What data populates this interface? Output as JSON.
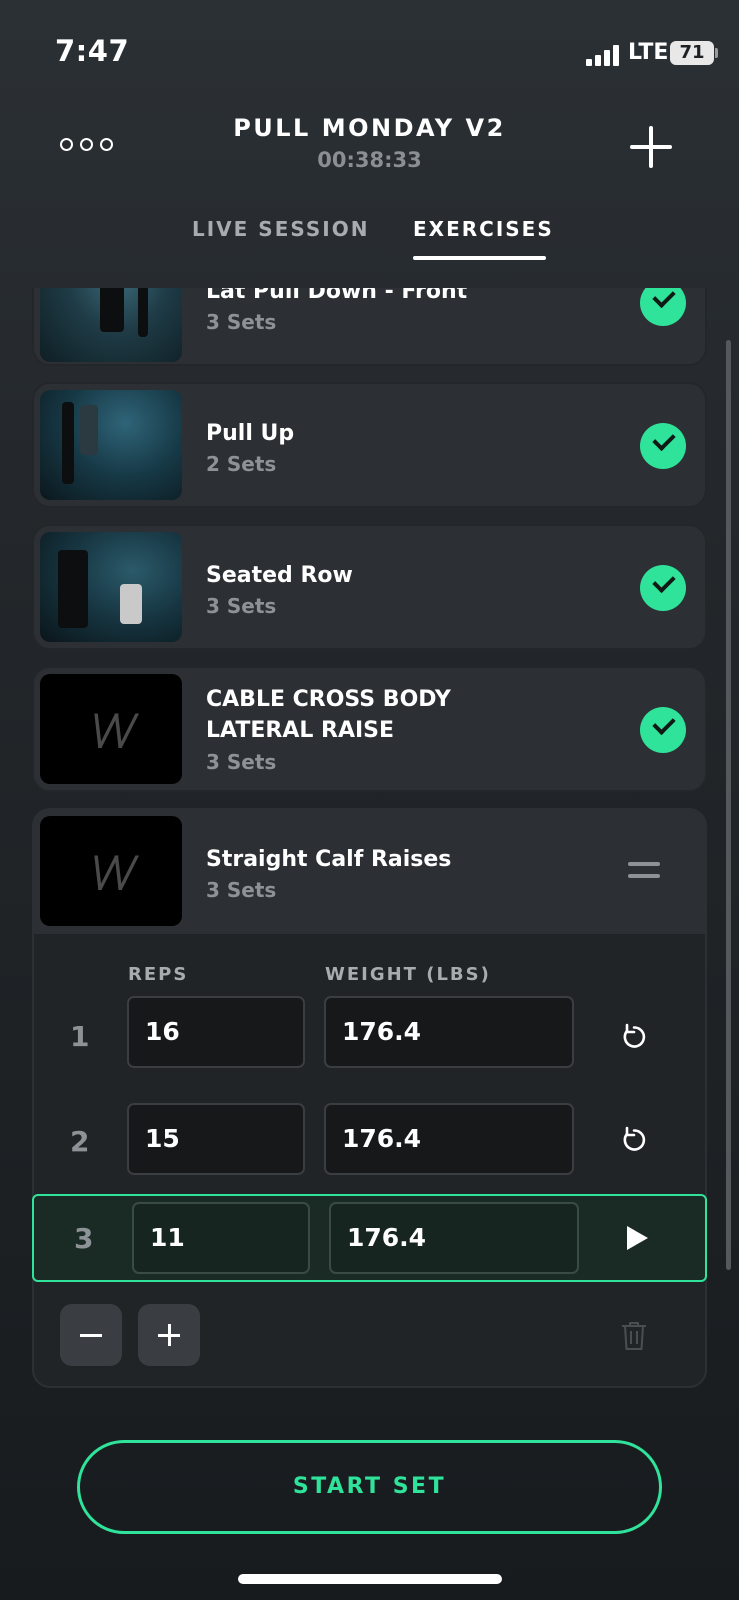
{
  "status_bar": {
    "time": "7:47",
    "network": "LTE",
    "battery": "71"
  },
  "header": {
    "title": "PULL MONDAY V2",
    "timer": "00:38:33"
  },
  "tabs": [
    {
      "label": "LIVE SESSION",
      "active": false
    },
    {
      "label": "EXERCISES",
      "active": true
    }
  ],
  "exercises": [
    {
      "name": "Lat Pull Down - Front",
      "sets": "3 Sets",
      "completed": true
    },
    {
      "name": "Pull Up",
      "sets": "2 Sets",
      "completed": true
    },
    {
      "name": "Seated Row",
      "sets": "3 Sets",
      "completed": true
    },
    {
      "name_line1": "CABLE CROSS BODY",
      "name_line2": "LATERAL RAISE",
      "sets": "3 Sets",
      "completed": true
    },
    {
      "name": "Straight Calf Raises",
      "sets": "3 Sets",
      "completed": false
    }
  ],
  "set_table": {
    "reps_header": "REPS",
    "weight_header": "WEIGHT (LBS)",
    "rows": [
      {
        "num": "1",
        "reps": "16",
        "weight": "176.4",
        "state": "done"
      },
      {
        "num": "2",
        "reps": "15",
        "weight": "176.4",
        "state": "done"
      },
      {
        "num": "3",
        "reps": "11",
        "weight": "176.4",
        "state": "active"
      }
    ]
  },
  "logo_text": "\\/\\/",
  "start_button": "START SET",
  "colors": {
    "accent": "#2fe39a",
    "background": "#24282c",
    "card": "#2c3034"
  }
}
